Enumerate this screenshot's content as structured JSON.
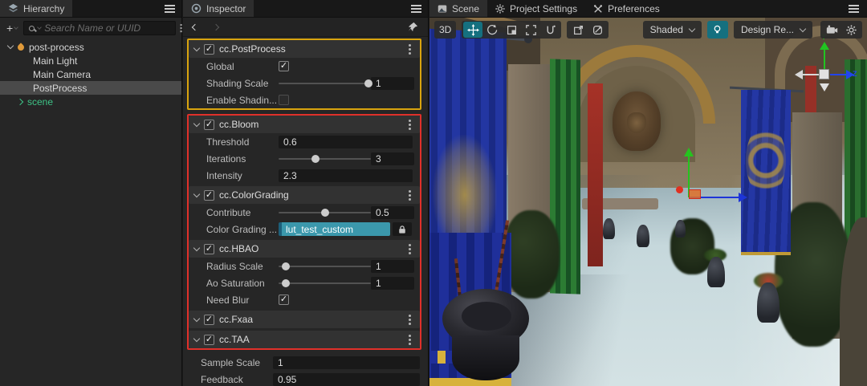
{
  "hierarchy": {
    "tab_label": "Hierarchy",
    "add_label": "+",
    "search_placeholder": "Search Name or UUID",
    "tree": {
      "root_label": "post-process",
      "main_light": "Main Light",
      "main_camera": "Main Camera",
      "postprocess": "PostProcess",
      "scene": "scene"
    }
  },
  "inspector": {
    "tab_label": "Inspector",
    "postprocess": {
      "title": "cc.PostProcess",
      "global_label": "Global",
      "shading_scale_label": "Shading Scale",
      "shading_scale_value": "1",
      "enable_shading_label": "Enable Shadin..."
    },
    "bloom": {
      "title": "cc.Bloom",
      "threshold_label": "Threshold",
      "threshold_value": "0.6",
      "iterations_label": "Iterations",
      "iterations_value": "3",
      "intensity_label": "Intensity",
      "intensity_value": "2.3"
    },
    "colorgrading": {
      "title": "cc.ColorGrading",
      "contribute_label": "Contribute",
      "contribute_value": "0.5",
      "lut_label": "Color Grading ...",
      "lut_value": "lut_test_custom"
    },
    "hbao": {
      "title": "cc.HBAO",
      "radius_label": "Radius Scale",
      "radius_value": "1",
      "saturation_label": "Ao Saturation",
      "saturation_value": "1",
      "blur_label": "Need Blur"
    },
    "fxaa": {
      "title": "cc.Fxaa"
    },
    "taa": {
      "title": "cc.TAA",
      "sample_scale_label": "Sample Scale",
      "sample_scale_value": "1",
      "feedback_label": "Feedback",
      "feedback_value": "0.95"
    },
    "sliders": {
      "shading": 97,
      "iterations": 40,
      "contribute": 50,
      "radius": 8,
      "saturation": 8
    }
  },
  "scene": {
    "tabs": {
      "scene": "Scene",
      "project_settings": "Project Settings",
      "preferences": "Preferences"
    },
    "toolbar": {
      "mode_3d": "3D",
      "shaded": "Shaded",
      "design": "Design Re..."
    },
    "axis": {
      "y": "Y",
      "z": "Z"
    }
  },
  "colors": {
    "accent_teal": "#15707f",
    "highlight_yellow": "#d9a40e",
    "highlight_red": "#e0302a",
    "scene_node_green": "#3ec487",
    "lut_field_teal": "#3b98ac",
    "prefab_orange": "#e09a3a"
  }
}
